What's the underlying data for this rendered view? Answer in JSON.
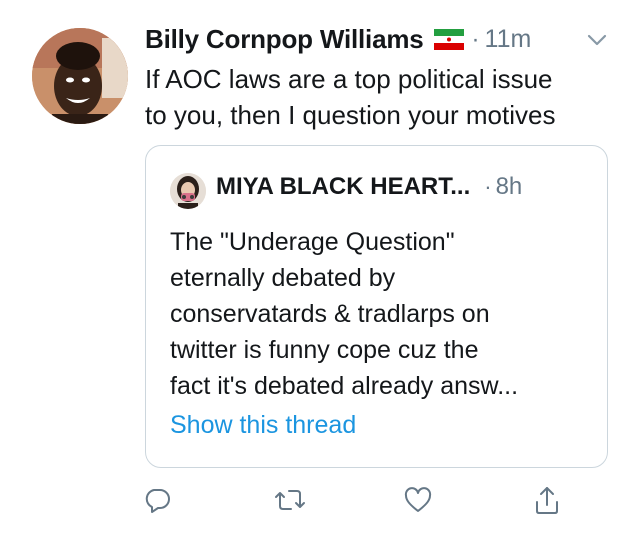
{
  "tweet": {
    "author_name": "Billy Cornpop Williams",
    "flag_icon": "iran-flag-icon",
    "separator": "·",
    "time": "11m",
    "body_lines": [
      "If AOC laws are a top political issue",
      "to you, then I question your motives"
    ]
  },
  "quoted_tweet": {
    "author_name": "MIYA BLACK HEART...",
    "separator": "·",
    "time": "8h",
    "body_lines": [
      "The \"Underage Question\"",
      "eternally debated by",
      "conservatards & tradlarps on",
      "twitter is funny cope cuz the",
      "fact it's debated already answ..."
    ],
    "show_thread_label": "Show this thread"
  },
  "actions": [
    {
      "icon": "reply-icon"
    },
    {
      "icon": "retweet-icon"
    },
    {
      "icon": "like-icon"
    },
    {
      "icon": "share-icon"
    }
  ],
  "colors": {
    "text": "#14171a",
    "secondary": "#657786",
    "link": "#1b95e0",
    "border": "#ccd6dd"
  }
}
